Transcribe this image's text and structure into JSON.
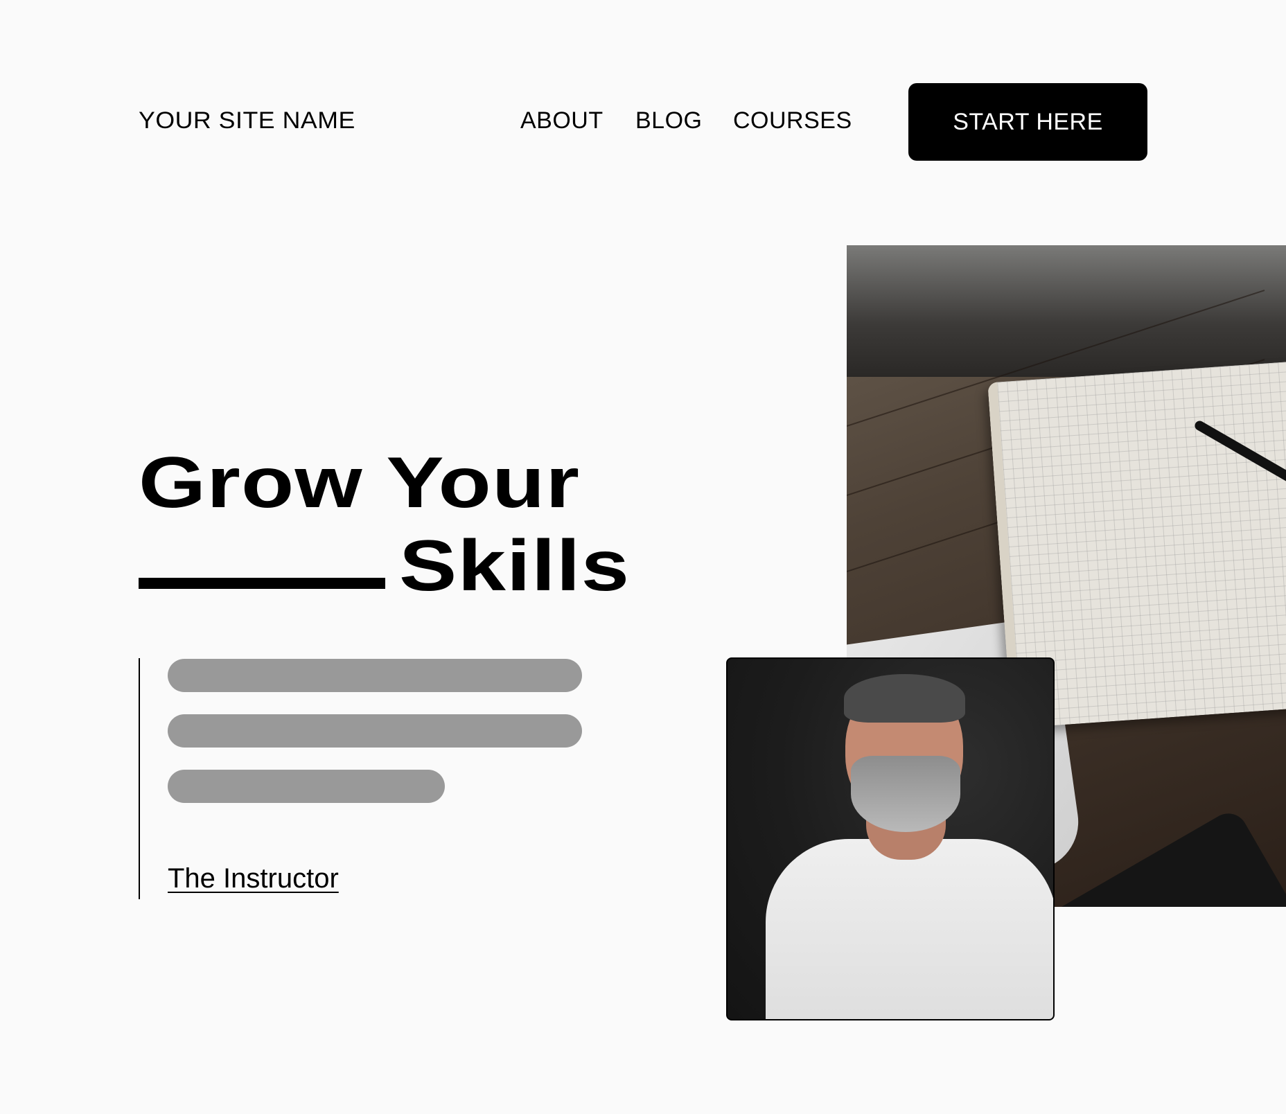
{
  "header": {
    "site_name": "YOUR SITE NAME",
    "nav": [
      "ABOUT",
      "BLOG",
      "COURSES"
    ],
    "cta_label": "START HERE"
  },
  "hero": {
    "headline_line1": "Grow Your",
    "headline_line2": "Skills",
    "instructor_link": "The Instructor"
  },
  "colors": {
    "background": "#fafafa",
    "text": "#000000",
    "cta_background": "#000000",
    "cta_text": "#ffffff",
    "placeholder_bar": "#999999"
  }
}
